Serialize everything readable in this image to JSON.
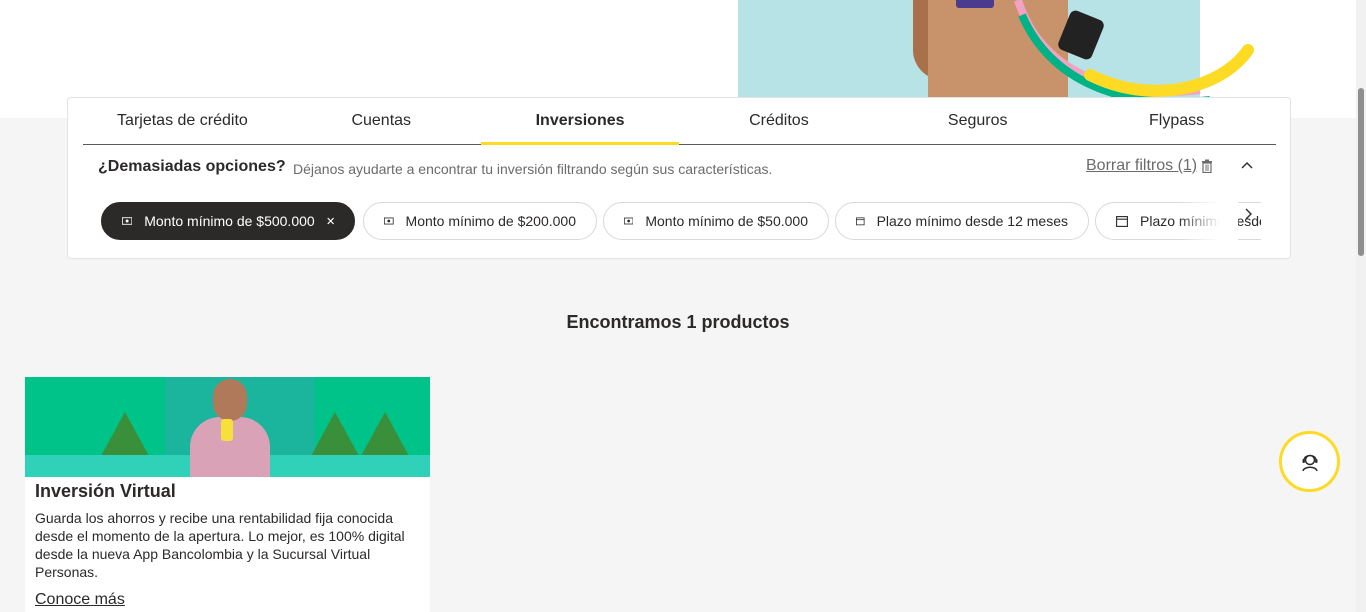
{
  "tabs": [
    {
      "label": "Tarjetas de crédito",
      "active": false
    },
    {
      "label": "Cuentas",
      "active": false
    },
    {
      "label": "Inversiones",
      "active": true
    },
    {
      "label": "Créditos",
      "active": false
    },
    {
      "label": "Seguros",
      "active": false
    },
    {
      "label": "Flypass",
      "active": false
    }
  ],
  "filters": {
    "title": "¿Demasiadas opciones?",
    "help_text": "Déjanos ayudarte a encontrar tu inversión filtrando según sus características.",
    "clear_label": "Borrar filtros (1)",
    "chips": [
      {
        "label": "Monto mínimo de $500.000",
        "icon": "cash-icon",
        "selected": true
      },
      {
        "label": "Monto mínimo de $200.000",
        "icon": "cash-icon",
        "selected": false
      },
      {
        "label": "Monto mínimo de $50.000",
        "icon": "cash-icon",
        "selected": false
      },
      {
        "label": "Plazo mínimo desde 12 meses",
        "icon": "calendar-icon",
        "selected": false
      },
      {
        "label": "Plazo mínimo desde",
        "icon": "calendar-icon",
        "selected": false
      }
    ]
  },
  "results": {
    "title": "Encontramos 1 productos"
  },
  "product": {
    "name": "Inversión Virtual",
    "description": "Guarda los ahorros y recibe una rentabilidad fija conocida desde el momento de la apertura. Lo mejor, es 100% digital desde la nueva App Bancolombia y la Sucursal Virtual Personas.",
    "link_label": "Conoce más"
  },
  "colors": {
    "accent": "#fdda24",
    "text": "#2c2a29",
    "selected_chip": "#2c2a29",
    "background": "#f5f5f5"
  }
}
